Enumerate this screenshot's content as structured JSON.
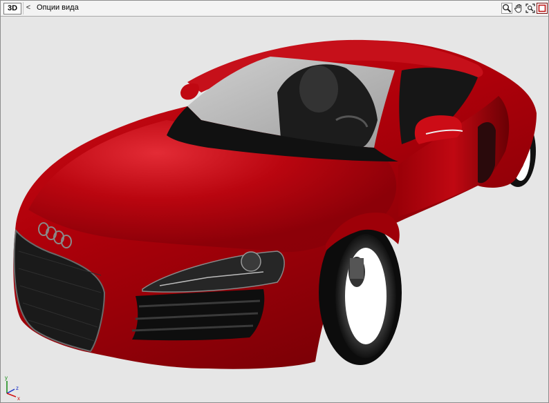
{
  "toolbar": {
    "mode_label": "3D",
    "back_label": "<",
    "view_options_label": "Опции вида",
    "tools": [
      {
        "icon": "zoom-icon"
      },
      {
        "icon": "pan-hand-icon"
      },
      {
        "icon": "zoom-extents-icon"
      },
      {
        "icon": "maximize-viewport-icon"
      }
    ]
  },
  "viewport": {
    "background_color": "#e6e6e6",
    "model": "car-model",
    "body_color": "#b1000b"
  },
  "axis_gizmo": {
    "y_label": "y",
    "z_label": "z",
    "x_label": "x",
    "colors": {
      "x": "#d01010",
      "y": "#108a10",
      "z": "#1830c8"
    }
  }
}
